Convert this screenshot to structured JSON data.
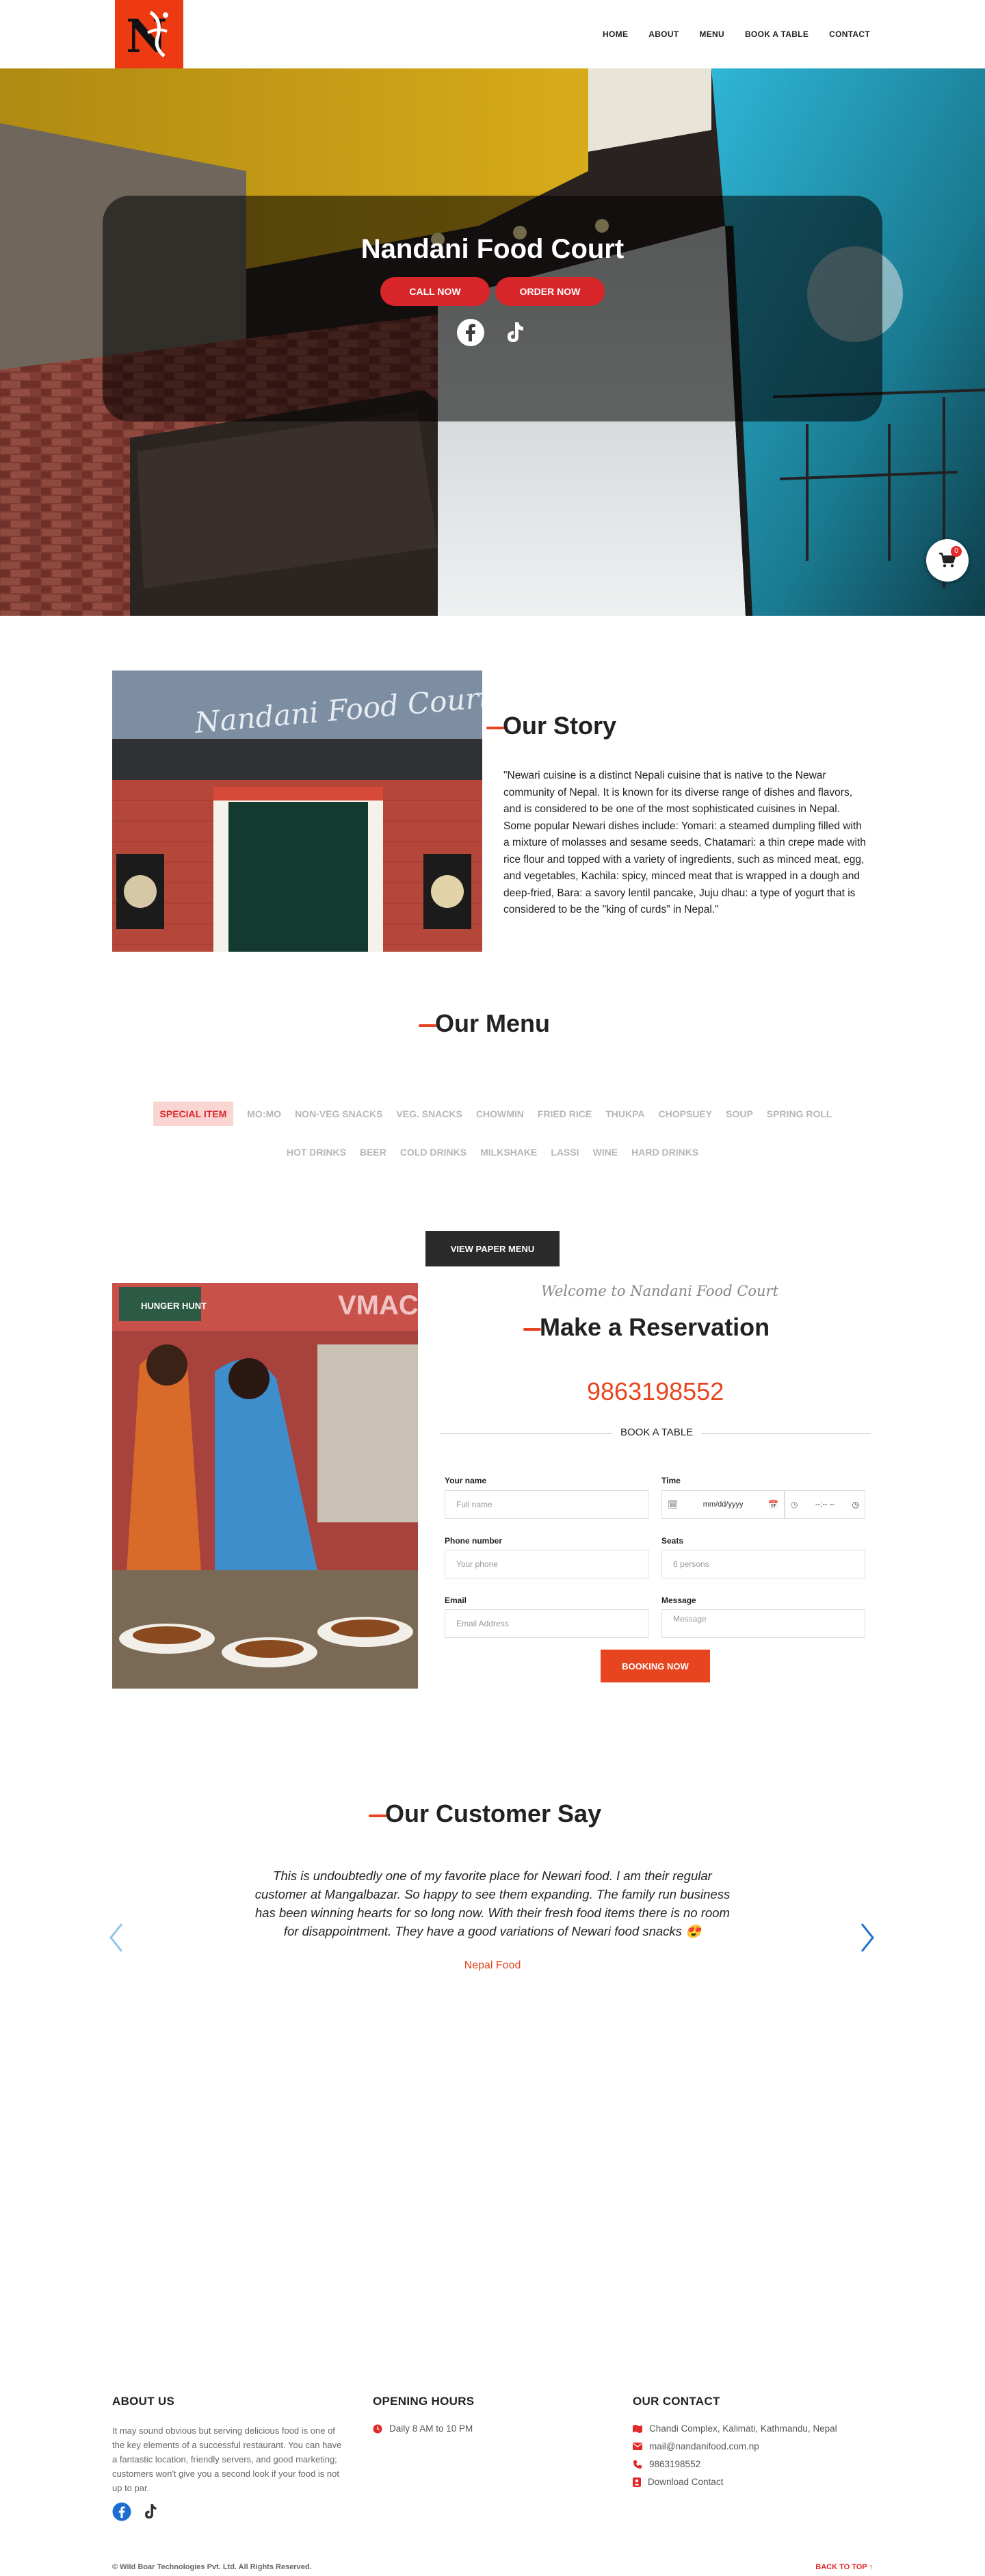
{
  "nav": {
    "logo_alt": "Nandani Food Court logo",
    "items": [
      "HOME",
      "ABOUT",
      "MENU",
      "BOOK A TABLE",
      "CONTACT"
    ]
  },
  "hero": {
    "title": "Nandani Food Court",
    "call_button": "CALL NOW",
    "order_button": "ORDER NOW",
    "social_icons": [
      "facebook-icon",
      "tiktok-icon"
    ],
    "cart_count": "0"
  },
  "story": {
    "title": "Our Story",
    "sign_text": "Nandani Food Court",
    "text": "\"Newari cuisine is a distinct Nepali cuisine that is native to the Newar community of Nepal. It is known for its diverse range of dishes and flavors, and is considered to be one of the most sophisticated cuisines in Nepal. Some popular Newari dishes include: Yomari: a steamed dumpling filled with a mixture of molasses and sesame seeds, Chatamari: a thin crepe made with rice flour and topped with a variety of ingredients, such as minced meat, egg, and vegetables, Kachila: spicy, minced meat that is wrapped in a dough and deep-fried, Bara: a savory lentil pancake, Juju dhau: a type of yogurt that is considered to be the \"king of curds\" in Nepal.\""
  },
  "menu": {
    "title": "Our Menu",
    "tabs_row1": [
      "SPECIAL ITEM",
      "MO:MO",
      "NON-VEG SNACKS",
      "VEG. SNACKS",
      "CHOWMIN",
      "FRIED RICE",
      "THUKPA",
      "CHOPSUEY",
      "SOUP",
      "SPRING ROLL"
    ],
    "tabs_row2": [
      "HOT DRINKS",
      "BEER",
      "COLD DRINKS",
      "MILKSHAKE",
      "LASSI",
      "WINE",
      "HARD DRINKS"
    ],
    "active_tab": "SPECIAL ITEM",
    "paper_menu_button": "VIEW PAPER MENU"
  },
  "reservation": {
    "welcome": "Welcome to Nandani Food Court",
    "title": "Make a Reservation",
    "phone": "9863198552",
    "book_label": "BOOK A TABLE",
    "name_label": "Your name",
    "name_placeholder": "Full name",
    "time_label": "Time",
    "date_placeholder": "mm/dd/yyyy",
    "time_placeholder": "--:-- --",
    "phone_label": "Phone number",
    "phone_placeholder": "Your phone",
    "seats_label": "Seats",
    "seats_placeholder": "6 persons",
    "email_label": "Email",
    "email_placeholder": "Email Address",
    "message_label": "Message",
    "message_placeholder": "Message",
    "submit": "BOOKING NOW",
    "signboard": [
      "HUNGER HUNT",
      "VMAC"
    ]
  },
  "testimonial": {
    "title": "Our Customer Say",
    "quote": "This is undoubtedly one of my favorite place for Newari food. I am their regular customer at Mangalbazar. So happy to see them expanding. The family run business has been winning hearts for so long now. With their fresh food items there is no room for disappointment. They have a good variations of Newari food snacks 😍",
    "author": "Nepal Food"
  },
  "footer": {
    "about_title": "ABOUT US",
    "about_text": "It may sound obvious but serving delicious food is one of the key elements of a successful restaurant. You can have a fantastic location, friendly servers, and good marketing; customers won't give you a second look if your food is not up to par.",
    "hours_title": "OPENING HOURS",
    "hours": "Daily 8 AM to 10 PM",
    "contact_title": "OUR CONTACT",
    "address": "Chandi Complex, Kalimati, Kathmandu, Nepal",
    "email": "mail@nandanifood.com.np",
    "phone": "9863198552",
    "download": "Download Contact",
    "copyright": "© Wild Boar Technologies Pvt. Ltd. All Rights Reserved.",
    "back_to_top": "BACK TO TOP ↑"
  },
  "colors": {
    "accent": "#e6451f",
    "brand_red": "#d9262b",
    "logo_bg": "#ee3a12",
    "dark_button": "#2b2b2b"
  }
}
